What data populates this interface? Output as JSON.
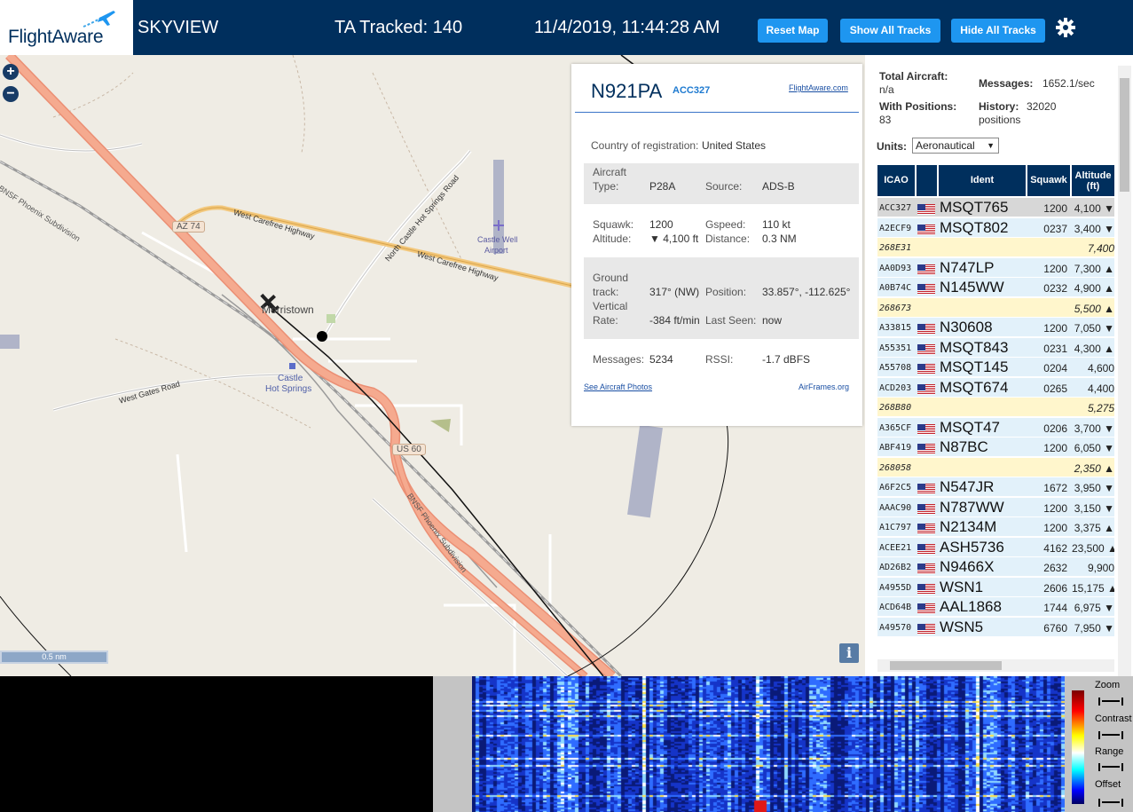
{
  "header": {
    "brand": "FlightAware",
    "app_name": "SKYVIEW",
    "ta_tracked": "TA Tracked: 140",
    "datetime": "11/4/2019, 11:44:28 AM",
    "reset_map": "Reset Map",
    "show_all_tracks": "Show All Tracks",
    "hide_all_tracks": "Hide All Tracks",
    "brand_color": "#002f5d",
    "button_color": "#1e96f0"
  },
  "map": {
    "zoom_in": "+",
    "zoom_out": "−",
    "labels": {
      "bnsf1": "BNSF Phoenix Subdivision",
      "bnsf2": "BNSF Phoenix Subdivision",
      "west_carefree_1": "West Carefree Highway",
      "west_carefree_2": "West Carefree Highway",
      "north_castle": "North Castle Hot Springs Road",
      "castle_well": "Castle Well",
      "airport": "Airport",
      "morristown": "Morristown",
      "castle": "Castle",
      "hot_springs": "Hot Springs",
      "west_gates": "West Gates Road",
      "az74": "AZ 74",
      "us60": "US 60"
    },
    "scale": "0.5 nm",
    "info": "i"
  },
  "popup": {
    "registration": "N921PA",
    "icao": "ACC327",
    "fa_link": "FlightAware.com",
    "country_label": "Country of registration:",
    "country": "United States",
    "aircraft_type_label_1": "Aircraft",
    "aircraft_type_label_2": "Type:",
    "aircraft_type": "P28A",
    "source_label": "Source:",
    "source": "ADS-B",
    "squawk_label": "Squawk:",
    "squawk": "1200",
    "gspeed_label": "Gspeed:",
    "gspeed": "110 kt",
    "altitude_label": "Altitude:",
    "altitude": "▼ 4,100 ft",
    "distance_label": "Distance:",
    "distance": "0.3 NM",
    "ground_track_label_1": "Ground",
    "ground_track_label_2": "track:",
    "ground_track": "317° (NW)",
    "position_label": "Position:",
    "position": "33.857°, -112.625°",
    "vertical_label_1": "Vertical",
    "vertical_label_2": "Rate:",
    "vertical_rate": "-384 ft/min",
    "last_seen_label": "Last Seen:",
    "last_seen": "now",
    "messages_label": "Messages:",
    "messages": "5234",
    "rssi_label": "RSSI:",
    "rssi": "-1.7 dBFS",
    "photos_link": "See Aircraft Photos",
    "airframes_link": "AirFrames.org"
  },
  "sidebar": {
    "total_aircraft_label": "Total Aircraft:",
    "total_aircraft": "n/a",
    "messages_label": "Messages:",
    "messages": "1652.1/sec",
    "with_positions_label": "With Positions:",
    "with_positions": "83",
    "history_label": "History:",
    "history_value": "32020",
    "history_unit": "positions",
    "units_label": "Units:",
    "units_value": "Aeronautical",
    "columns": {
      "icao": "ICAO",
      "ident": "Ident",
      "squawk": "Squawk",
      "altitude": "Altitude",
      "altitude_unit": "(ft)"
    },
    "rows": [
      {
        "icao": "ACC327",
        "flag": true,
        "ident": "MSQT765",
        "squawk": "1200",
        "alt": "4,100 ▼",
        "type": "sel"
      },
      {
        "icao": "A2ECF9",
        "flag": true,
        "ident": "MSQT802",
        "squawk": "0237",
        "alt": "3,400 ▼",
        "type": "adsb"
      },
      {
        "icao": "268E31",
        "flag": false,
        "ident": "",
        "squawk": "",
        "alt": "7,400",
        "type": "mlat"
      },
      {
        "icao": "AA0D93",
        "flag": true,
        "ident": "N747LP",
        "squawk": "1200",
        "alt": "7,300 ▲",
        "type": "adsb"
      },
      {
        "icao": "A0B74C",
        "flag": true,
        "ident": "N145WW",
        "squawk": "0232",
        "alt": "4,900 ▲",
        "type": "adsb"
      },
      {
        "icao": "268673",
        "flag": false,
        "ident": "",
        "squawk": "",
        "alt": "5,500 ▲",
        "type": "mlat"
      },
      {
        "icao": "A33815",
        "flag": true,
        "ident": "N30608",
        "squawk": "1200",
        "alt": "7,050 ▼",
        "type": "adsb"
      },
      {
        "icao": "A55351",
        "flag": true,
        "ident": "MSQT843",
        "squawk": "0231",
        "alt": "4,300 ▲",
        "type": "adsb"
      },
      {
        "icao": "A55708",
        "flag": true,
        "ident": "MSQT145",
        "squawk": "0204",
        "alt": "4,600",
        "type": "adsb"
      },
      {
        "icao": "ACD203",
        "flag": true,
        "ident": "MSQT674",
        "squawk": "0265",
        "alt": "4,400",
        "type": "adsb"
      },
      {
        "icao": "268B80",
        "flag": false,
        "ident": "",
        "squawk": "",
        "alt": "5,275",
        "type": "mlat"
      },
      {
        "icao": "A365CF",
        "flag": true,
        "ident": "MSQT47",
        "squawk": "0206",
        "alt": "3,700 ▼",
        "type": "adsb"
      },
      {
        "icao": "ABF419",
        "flag": true,
        "ident": "N87BC",
        "squawk": "1200",
        "alt": "6,050 ▼",
        "type": "adsb"
      },
      {
        "icao": "268058",
        "flag": false,
        "ident": "",
        "squawk": "",
        "alt": "2,350 ▲",
        "type": "mlat"
      },
      {
        "icao": "A6F2C5",
        "flag": true,
        "ident": "N547JR",
        "squawk": "1672",
        "alt": "3,950 ▼",
        "type": "adsb"
      },
      {
        "icao": "AAAC90",
        "flag": true,
        "ident": "N787WW",
        "squawk": "1200",
        "alt": "3,150 ▼",
        "type": "adsb"
      },
      {
        "icao": "A1C797",
        "flag": true,
        "ident": "N2134M",
        "squawk": "1200",
        "alt": "3,375 ▲",
        "type": "adsb"
      },
      {
        "icao": "ACEE21",
        "flag": true,
        "ident": "ASH5736",
        "squawk": "4162",
        "alt": "23,500 ▲",
        "type": "adsb"
      },
      {
        "icao": "AD26B2",
        "flag": true,
        "ident": "N9466X",
        "squawk": "2632",
        "alt": "9,900",
        "type": "adsb"
      },
      {
        "icao": "A4955D",
        "flag": true,
        "ident": "WSN1",
        "squawk": "2606",
        "alt": "15,175 ▲",
        "type": "adsb"
      },
      {
        "icao": "ACD64B",
        "flag": true,
        "ident": "AAL1868",
        "squawk": "1744",
        "alt": "6,975 ▼",
        "type": "adsb"
      },
      {
        "icao": "A49570",
        "flag": true,
        "ident": "WSN5",
        "squawk": "6760",
        "alt": "7,950 ▼",
        "type": "adsb"
      }
    ]
  },
  "waterfall": {
    "zoom_label": "Zoom",
    "contrast_label": "Contrast",
    "range_label": "Range",
    "offset_label": "Offset"
  }
}
